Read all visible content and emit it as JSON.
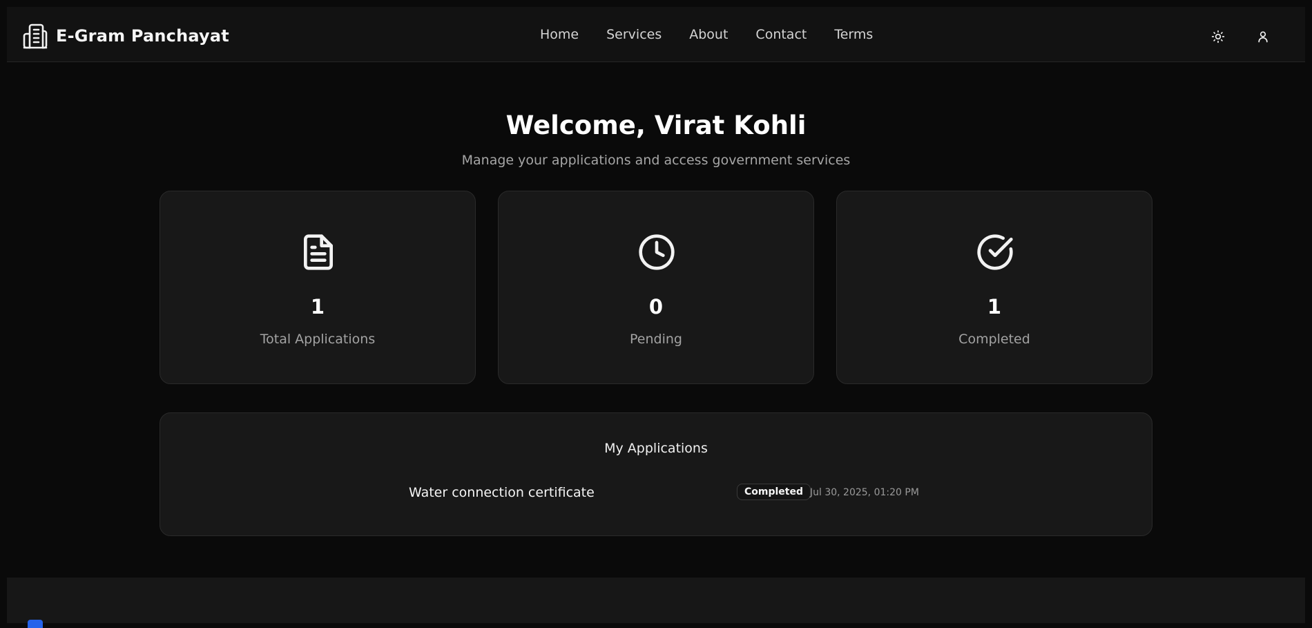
{
  "header": {
    "brand_name": "E-Gram Panchayat",
    "brand_icon": "building-icon",
    "nav": [
      {
        "label": "Home"
      },
      {
        "label": "Services"
      },
      {
        "label": "About"
      },
      {
        "label": "Contact"
      },
      {
        "label": "Terms"
      }
    ],
    "theme_icon": "sun-icon",
    "user_icon": "user-icon"
  },
  "hero": {
    "title": "Welcome, Virat Kohli",
    "subtitle": "Manage your applications and access government services"
  },
  "stats": [
    {
      "icon": "document-icon",
      "value": "1",
      "label": "Total Applications"
    },
    {
      "icon": "clock-icon",
      "value": "0",
      "label": "Pending"
    },
    {
      "icon": "check-circle-icon",
      "value": "1",
      "label": "Completed"
    }
  ],
  "applications": {
    "title": "My Applications",
    "items": [
      {
        "name": "Water connection certificate",
        "status": "Completed",
        "date": "Jul 30, 2025, 01:20 PM"
      }
    ]
  },
  "colors": {
    "background": "#0a0a0a",
    "surface": "#181818",
    "accent": "#2563eb"
  }
}
